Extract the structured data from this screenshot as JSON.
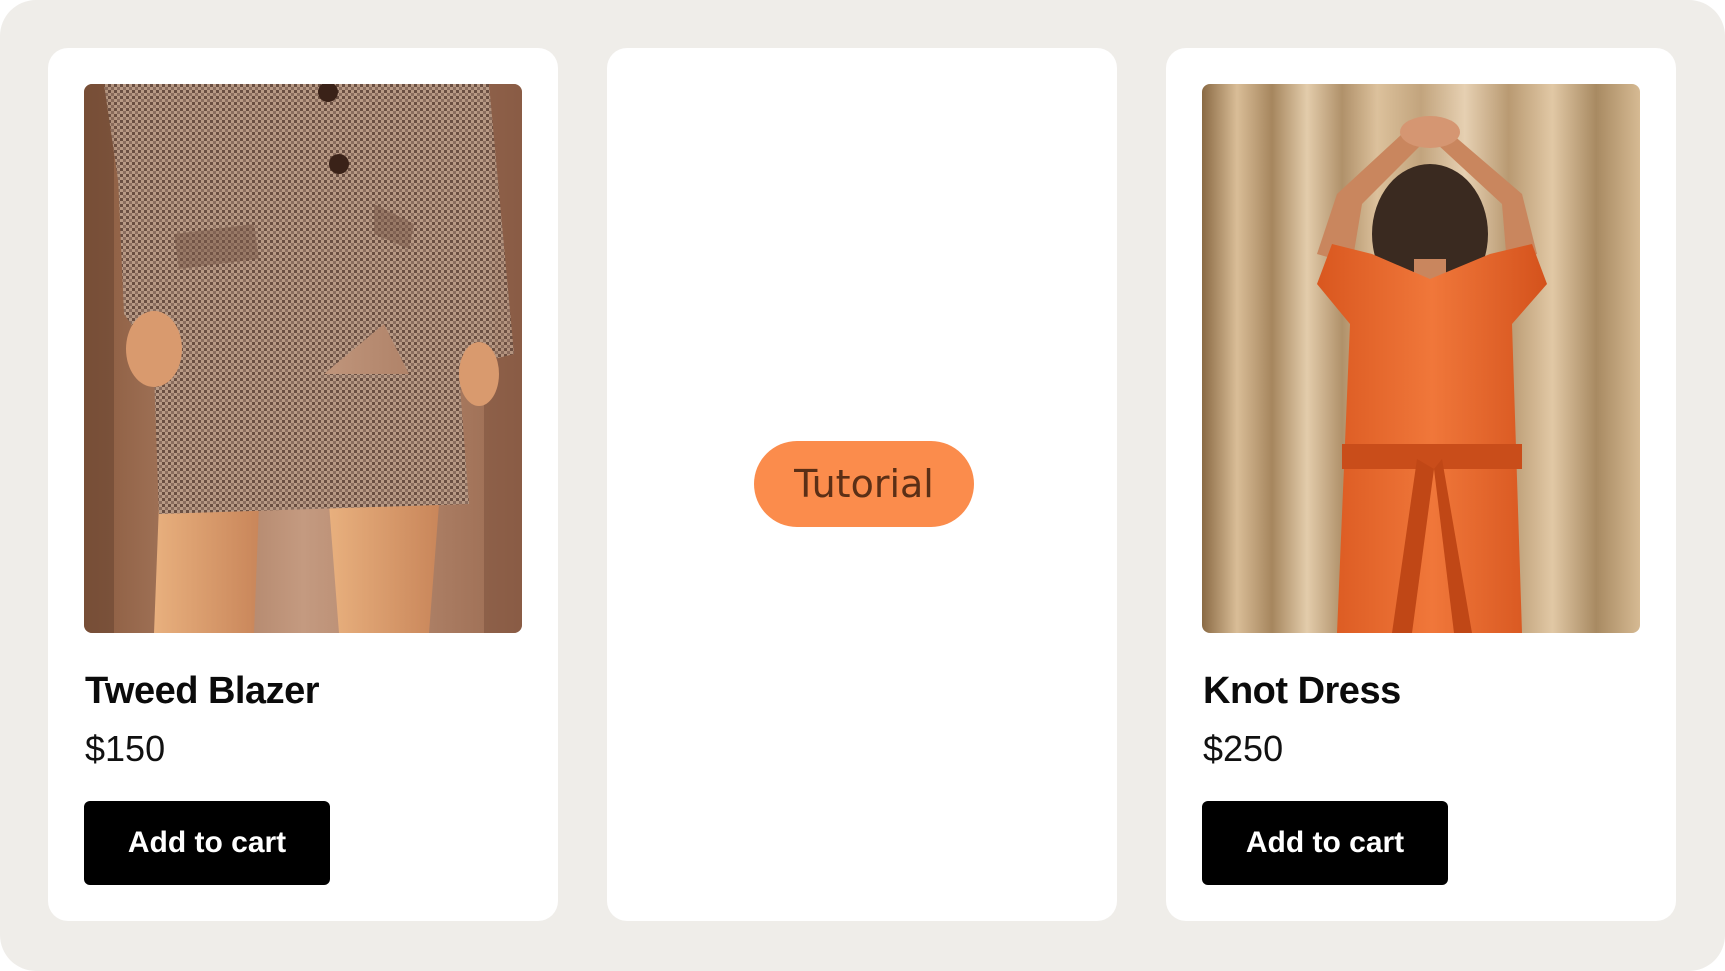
{
  "products": [
    {
      "name": "Tweed Blazer",
      "price": "$150",
      "button_label": "Add to cart",
      "image": "woman-in-houndstooth-tweed-blazer-and-skirt",
      "accent": "#c9a48a"
    },
    {
      "name": "Knot Dress",
      "price": "$250",
      "button_label": "Add to cart",
      "image": "woman-in-orange-knot-dress-from-behind",
      "accent": "#ea6a2c"
    }
  ],
  "placeholder": {
    "badge_label": "Tutorial",
    "badge_color": "#fb8c4c",
    "badge_text_color": "#5b2f16"
  },
  "colors": {
    "frame_background": "#efede9",
    "card_background": "#ffffff",
    "button_background": "#000000",
    "button_text": "#ffffff"
  }
}
